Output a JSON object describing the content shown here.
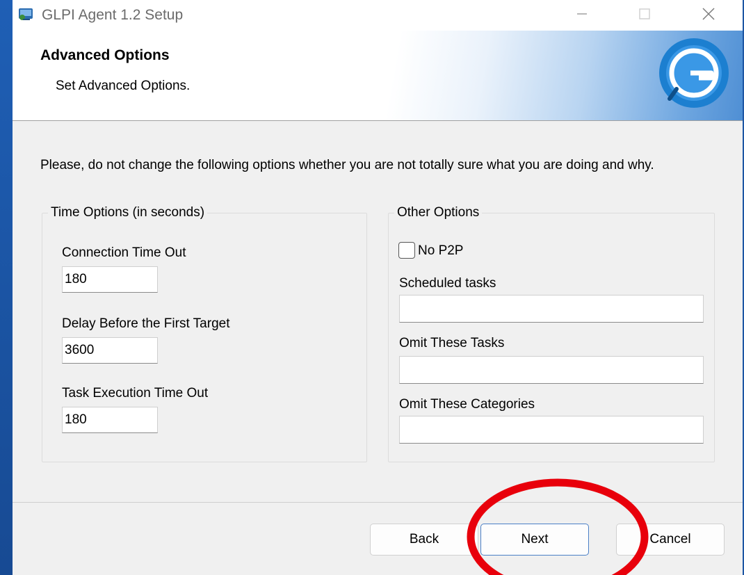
{
  "window": {
    "title": "GLPI Agent 1.2 Setup",
    "controls": {
      "minimize": "minimize-icon",
      "maximize": "maximize-icon",
      "close": "close-icon"
    }
  },
  "header": {
    "title": "Advanced Options",
    "subtitle": "Set Advanced Options.",
    "logo": "glpi-logo-icon"
  },
  "intro": "Please, do not change the following options whether you are not totally sure what you are doing and why.",
  "time_options": {
    "legend": "Time Options (in seconds)",
    "fields": [
      {
        "label": "Connection Time Out",
        "value": "180"
      },
      {
        "label": "Delay Before the First Target",
        "value": "3600"
      },
      {
        "label": "Task Execution Time Out",
        "value": "180"
      }
    ]
  },
  "other_options": {
    "legend": "Other Options",
    "no_p2p": {
      "label": "No P2P",
      "checked": false
    },
    "fields": [
      {
        "label": "Scheduled tasks",
        "value": ""
      },
      {
        "label": "Omit These Tasks",
        "value": ""
      },
      {
        "label": "Omit These Categories",
        "value": ""
      }
    ]
  },
  "buttons": {
    "back": "Back",
    "next": "Next",
    "cancel": "Cancel"
  },
  "colors": {
    "annotation_ring": "#e8000b",
    "logo_blue": "#1c7fd0",
    "focus_border": "#4a7fc6"
  }
}
